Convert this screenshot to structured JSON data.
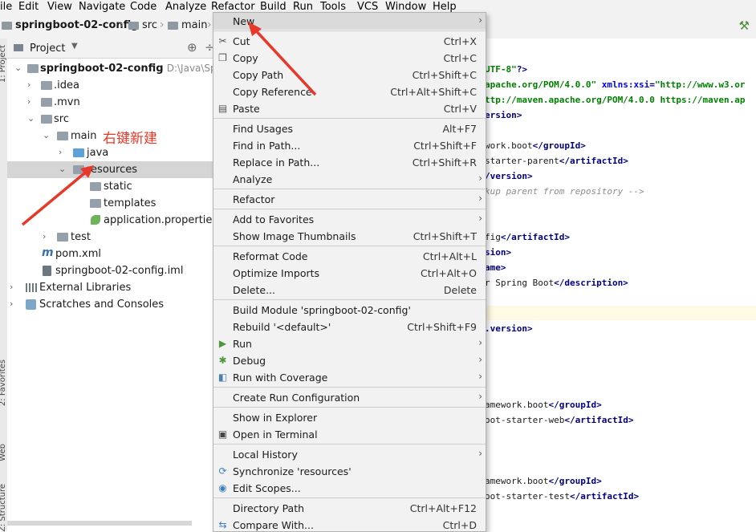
{
  "menubar": [
    "ile",
    "Edit",
    "View",
    "Navigate",
    "Code",
    "Analyze",
    "Refactor",
    "Build",
    "Run",
    "Tools",
    "VCS",
    "Window",
    "Help"
  ],
  "breadcrumbs": [
    "springboot-02-config",
    "src",
    "main"
  ],
  "project_panel": {
    "title": "Project",
    "tree": [
      {
        "label": "springboot-02-config",
        "path": "D:\\Java\\Spring"
      },
      {
        "label": ".idea"
      },
      {
        "label": ".mvn"
      },
      {
        "label": "src"
      },
      {
        "label": "main"
      },
      {
        "label": "java"
      },
      {
        "label": "resources"
      },
      {
        "label": "static"
      },
      {
        "label": "templates"
      },
      {
        "label": "application.properties"
      },
      {
        "label": "test"
      },
      {
        "label": "pom.xml"
      },
      {
        "label": "springboot-02-config.iml"
      },
      {
        "label": "External Libraries"
      },
      {
        "label": "Scratches and Consoles"
      }
    ]
  },
  "annotation": "右键新建",
  "side_strip": [
    "1: Project",
    "2: Favorites",
    "Web",
    "Z: Structure"
  ],
  "editor_lines": [
    {
      "parts": [
        [
          "str",
          "UTF-8\""
        ],
        [
          "tag",
          "?>"
        ]
      ]
    },
    {
      "parts": [
        [
          "str",
          "apache.org/POM/4.0.0\" "
        ],
        [
          "attr",
          "xmlns:xsi"
        ],
        [
          "tag",
          "="
        ],
        [
          "str",
          "\"http://www.w3.or"
        ]
      ]
    },
    {
      "parts": [
        [
          "str",
          "ttp://maven.apache.org/POM/4.0.0 https://maven.ap"
        ]
      ]
    },
    {
      "parts": [
        [
          "tag",
          "ersion>"
        ]
      ]
    },
    {
      "parts": [
        [
          "plain",
          "work.boot"
        ],
        [
          "tag",
          "</groupId>"
        ]
      ]
    },
    {
      "parts": [
        [
          "plain",
          "starter-parent"
        ],
        [
          "tag",
          "</artifactId>"
        ]
      ]
    },
    {
      "parts": [
        [
          "tag",
          "/version>"
        ]
      ]
    },
    {
      "parts": [
        [
          "cm",
          "kup parent from repository -->"
        ]
      ]
    },
    {
      "parts": [
        [
          "plain",
          "fig"
        ],
        [
          "tag",
          "</artifactId>"
        ]
      ]
    },
    {
      "parts": [
        [
          "tag",
          "sion>"
        ]
      ]
    },
    {
      "parts": [
        [
          "tag",
          "ame>"
        ]
      ]
    },
    {
      "parts": [
        [
          "plain",
          "r Spring Boot"
        ],
        [
          "tag",
          "</description>"
        ]
      ]
    },
    {
      "parts": [
        [
          "tag",
          ".version>"
        ]
      ]
    },
    {
      "parts": [
        [
          "plain",
          "amework.boot"
        ],
        [
          "tag",
          "</groupId>"
        ]
      ]
    },
    {
      "parts": [
        [
          "plain",
          "oot-starter-web"
        ],
        [
          "tag",
          "</artifactId>"
        ]
      ]
    },
    {
      "parts": [
        [
          "plain",
          "amework.boot"
        ],
        [
          "tag",
          "</groupId>"
        ]
      ]
    },
    {
      "parts": [
        [
          "plain",
          "oot-starter-test"
        ],
        [
          "tag",
          "</artifactId>"
        ]
      ]
    }
  ],
  "context_menu": [
    {
      "label": "New",
      "shortcut": "",
      "submenu": true,
      "icon": ""
    },
    {
      "label": "Cut",
      "shortcut": "Ctrl+X",
      "icon": "scissors-icon"
    },
    {
      "label": "Copy",
      "shortcut": "Ctrl+C",
      "icon": "copy-icon"
    },
    {
      "label": "Copy Path",
      "shortcut": "Ctrl+Shift+C"
    },
    {
      "label": "Copy Reference",
      "shortcut": "Ctrl+Alt+Shift+C"
    },
    {
      "label": "Paste",
      "shortcut": "Ctrl+V",
      "icon": "paste-icon"
    },
    {
      "label": "Find Usages",
      "shortcut": "Alt+F7"
    },
    {
      "label": "Find in Path...",
      "shortcut": "Ctrl+Shift+F"
    },
    {
      "label": "Replace in Path...",
      "shortcut": "Ctrl+Shift+R"
    },
    {
      "label": "Analyze",
      "shortcut": "",
      "submenu": true
    },
    {
      "label": "Refactor",
      "shortcut": "",
      "submenu": true
    },
    {
      "label": "Add to Favorites",
      "shortcut": "",
      "submenu": true
    },
    {
      "label": "Show Image Thumbnails",
      "shortcut": "Ctrl+Shift+T"
    },
    {
      "label": "Reformat Code",
      "shortcut": "Ctrl+Alt+L"
    },
    {
      "label": "Optimize Imports",
      "shortcut": "Ctrl+Alt+O"
    },
    {
      "label": "Delete...",
      "shortcut": "Delete"
    },
    {
      "label": "Build Module 'springboot-02-config'",
      "shortcut": ""
    },
    {
      "label": "Rebuild '<default>'",
      "shortcut": "Ctrl+Shift+F9"
    },
    {
      "label": "Run",
      "shortcut": "",
      "submenu": true,
      "icon": "run-icon"
    },
    {
      "label": "Debug",
      "shortcut": "",
      "submenu": true,
      "icon": "debug-icon"
    },
    {
      "label": "Run with Coverage",
      "shortcut": "",
      "submenu": true,
      "icon": "coverage-icon"
    },
    {
      "label": "Create Run Configuration",
      "shortcut": "",
      "submenu": true
    },
    {
      "label": "Show in Explorer",
      "shortcut": ""
    },
    {
      "label": "Open in Terminal",
      "shortcut": "",
      "icon": "terminal-icon"
    },
    {
      "label": "Local History",
      "shortcut": "",
      "submenu": true
    },
    {
      "label": "Synchronize 'resources'",
      "shortcut": "",
      "icon": "sync-icon"
    },
    {
      "label": "Edit Scopes...",
      "shortcut": "",
      "icon": "scope-icon"
    },
    {
      "label": "Directory Path",
      "shortcut": "Ctrl+Alt+F12"
    },
    {
      "label": "Compare With...",
      "shortcut": "Ctrl+D",
      "icon": "compare-icon"
    }
  ],
  "colors": {
    "arrow": "#e8382a",
    "selection": "#d5d5d5",
    "menu_bg": "#f2f2f2"
  }
}
